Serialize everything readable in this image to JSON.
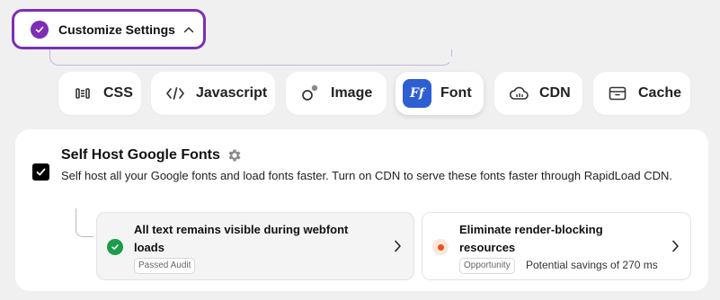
{
  "customize": {
    "label": "Customize Settings",
    "icons": {
      "check": "check-circle-icon",
      "chevron": "chevron-up-icon"
    }
  },
  "tabs": [
    {
      "label": "CSS",
      "icon": "css-icon"
    },
    {
      "label": "Javascript",
      "icon": "code-icon"
    },
    {
      "label": "Image",
      "icon": "image-icon"
    },
    {
      "label": "Font",
      "icon": "font-icon",
      "badge": "Ff",
      "active": true
    },
    {
      "label": "CDN",
      "icon": "cloud-icon"
    },
    {
      "label": "Cache",
      "icon": "cache-icon"
    }
  ],
  "setting": {
    "title": "Self Host Google Fonts",
    "checked": true,
    "description": "Self host all your Google fonts and load fonts faster. Turn on CDN to serve these fonts faster through RapidLoad CDN."
  },
  "audits": [
    {
      "title": "All text remains visible during webfont loads",
      "badge": "Passed Audit",
      "status": "pass",
      "status_color": "#1a9c4a"
    },
    {
      "title": "Eliminate render-blocking resources",
      "badge": "Opportunity",
      "savings": "Potential savings of 270 ms",
      "status": "opportunity",
      "status_color": "#e8501f"
    }
  ],
  "colors": {
    "accent": "#7d2eb4",
    "font_badge": "#2d5fd2",
    "background": "#f0f0f1"
  }
}
